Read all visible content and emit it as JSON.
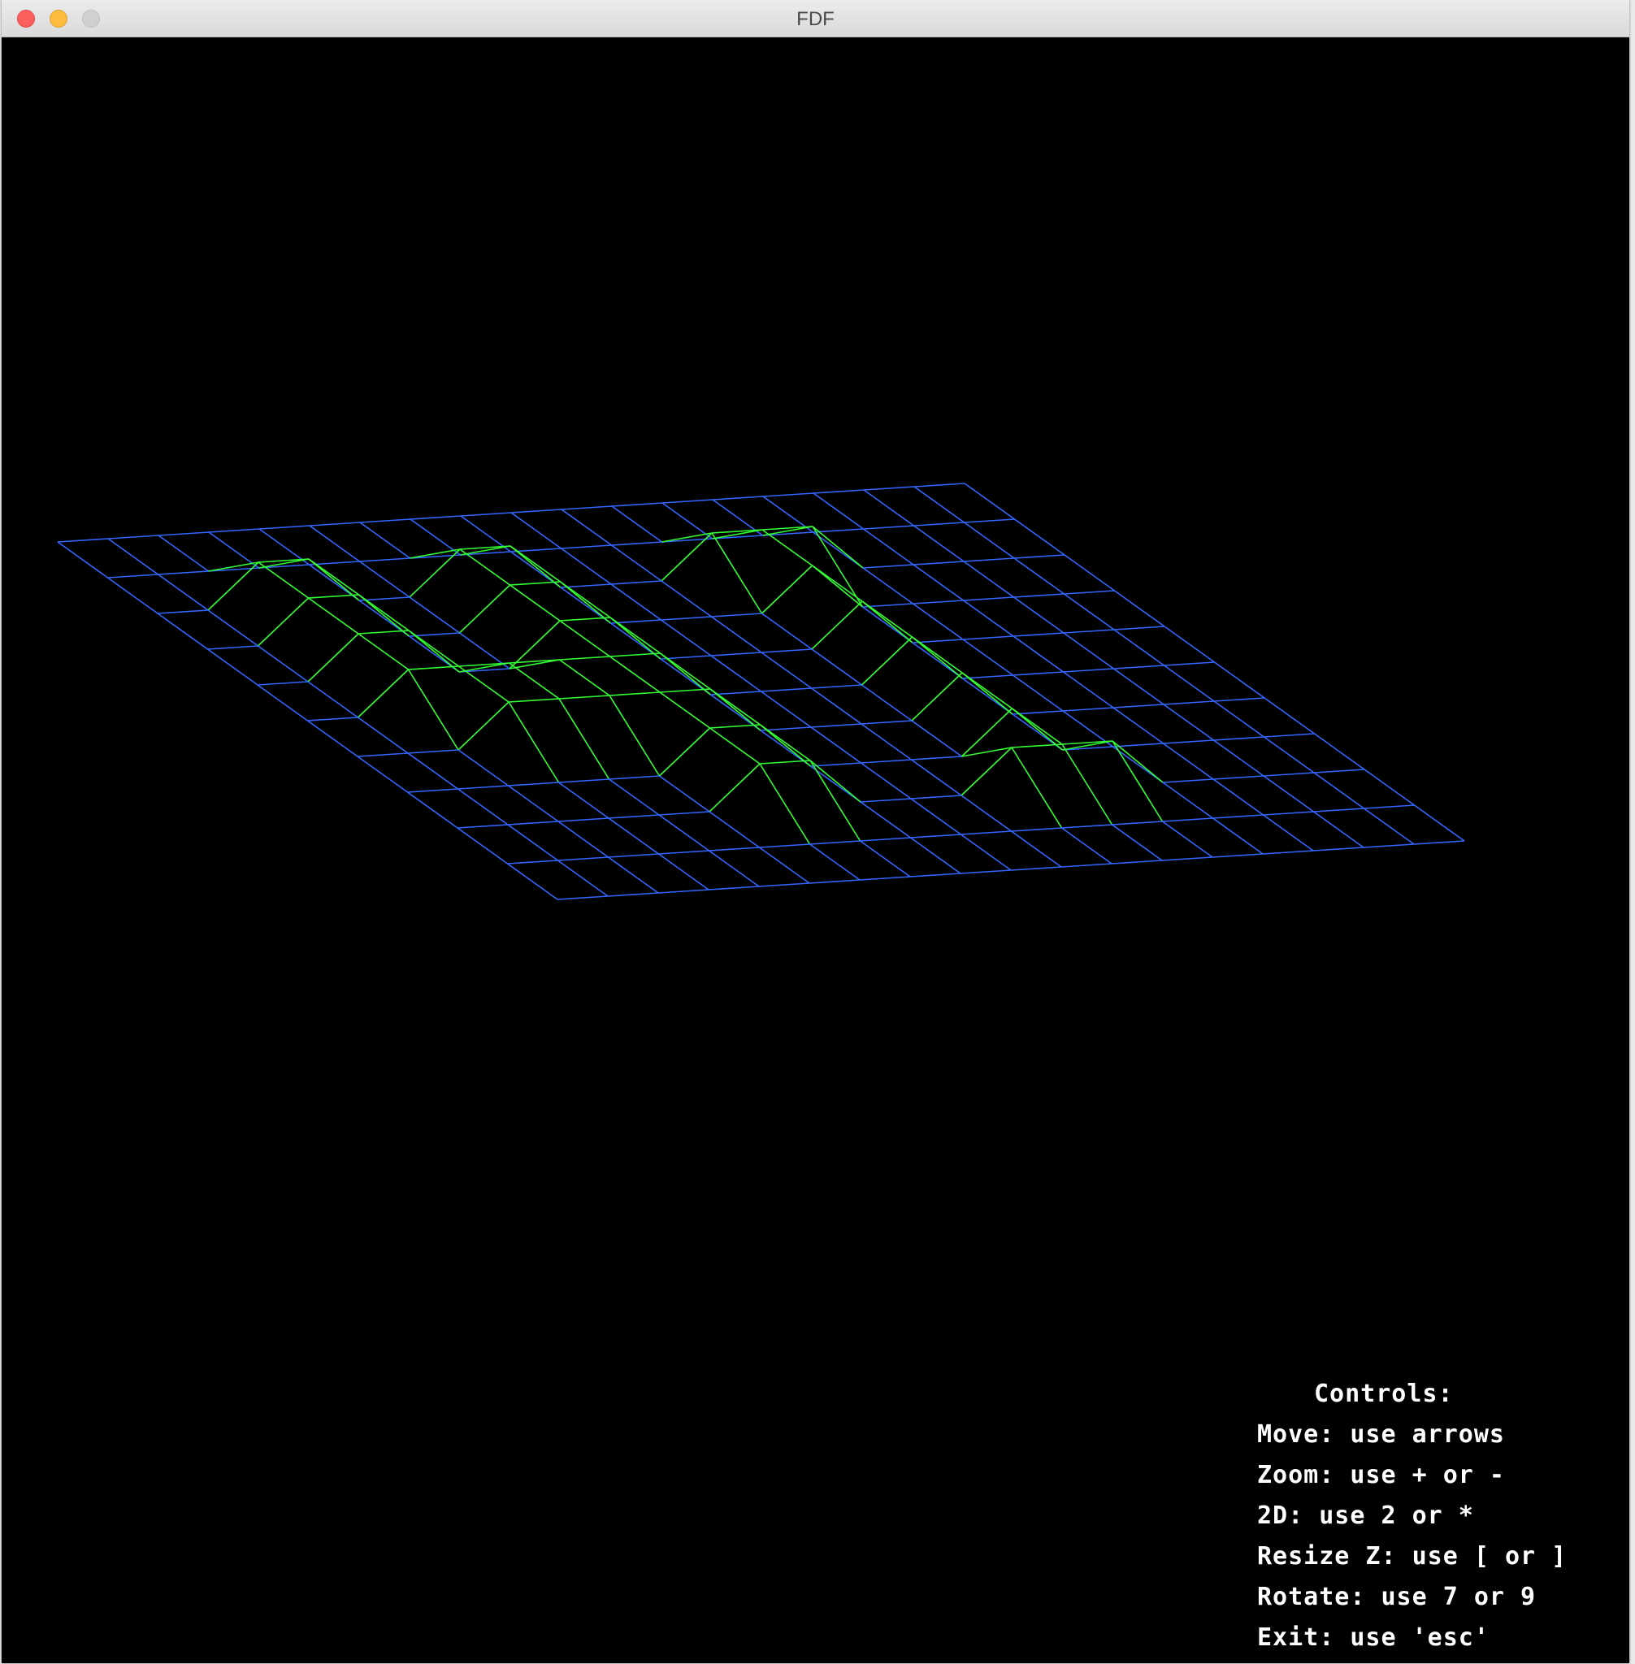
{
  "window": {
    "title": "FDF"
  },
  "colors": {
    "ground_wire": "#3366ff",
    "raised_wire": "#33ff33",
    "background": "#000000",
    "text": "#ffffff"
  },
  "controls": {
    "heading": "Controls:",
    "lines": [
      "Move: use arrows",
      "Zoom: use + or -",
      "2D: use 2 or *",
      "Resize Z: use [ or ]",
      "Rotate: use 7 or 9",
      "Exit: use 'esc'"
    ]
  },
  "map": {
    "rows": [
      [
        0,
        0,
        0,
        0,
        0,
        0,
        0,
        0,
        0,
        0,
        0,
        0,
        0,
        0,
        0,
        0,
        0,
        0,
        0
      ],
      [
        0,
        0,
        0,
        0,
        0,
        0,
        0,
        0,
        0,
        0,
        0,
        0,
        0,
        0,
        0,
        0,
        0,
        0,
        0
      ],
      [
        0,
        0,
        10,
        10,
        0,
        0,
        10,
        10,
        0,
        0,
        0,
        10,
        10,
        10,
        0,
        0,
        0,
        0,
        0
      ],
      [
        0,
        0,
        10,
        10,
        0,
        0,
        10,
        10,
        0,
        0,
        0,
        0,
        10,
        0,
        0,
        0,
        0,
        0,
        0
      ],
      [
        0,
        0,
        10,
        10,
        0,
        0,
        10,
        10,
        0,
        0,
        0,
        0,
        10,
        0,
        0,
        0,
        0,
        0,
        0
      ],
      [
        0,
        0,
        10,
        10,
        10,
        10,
        10,
        10,
        0,
        0,
        0,
        0,
        10,
        0,
        0,
        0,
        0,
        0,
        0
      ],
      [
        0,
        0,
        0,
        10,
        10,
        10,
        10,
        10,
        0,
        0,
        0,
        0,
        10,
        0,
        0,
        0,
        0,
        0,
        0
      ],
      [
        0,
        0,
        0,
        0,
        0,
        0,
        10,
        10,
        0,
        0,
        0,
        0,
        10,
        0,
        0,
        0,
        0,
        0,
        0
      ],
      [
        0,
        0,
        0,
        0,
        0,
        0,
        10,
        10,
        0,
        0,
        0,
        10,
        10,
        10,
        0,
        0,
        0,
        0,
        0
      ],
      [
        0,
        0,
        0,
        0,
        0,
        0,
        0,
        0,
        0,
        0,
        0,
        0,
        0,
        0,
        0,
        0,
        0,
        0,
        0
      ],
      [
        0,
        0,
        0,
        0,
        0,
        0,
        0,
        0,
        0,
        0,
        0,
        0,
        0,
        0,
        0,
        0,
        0,
        0,
        0
      ]
    ]
  }
}
